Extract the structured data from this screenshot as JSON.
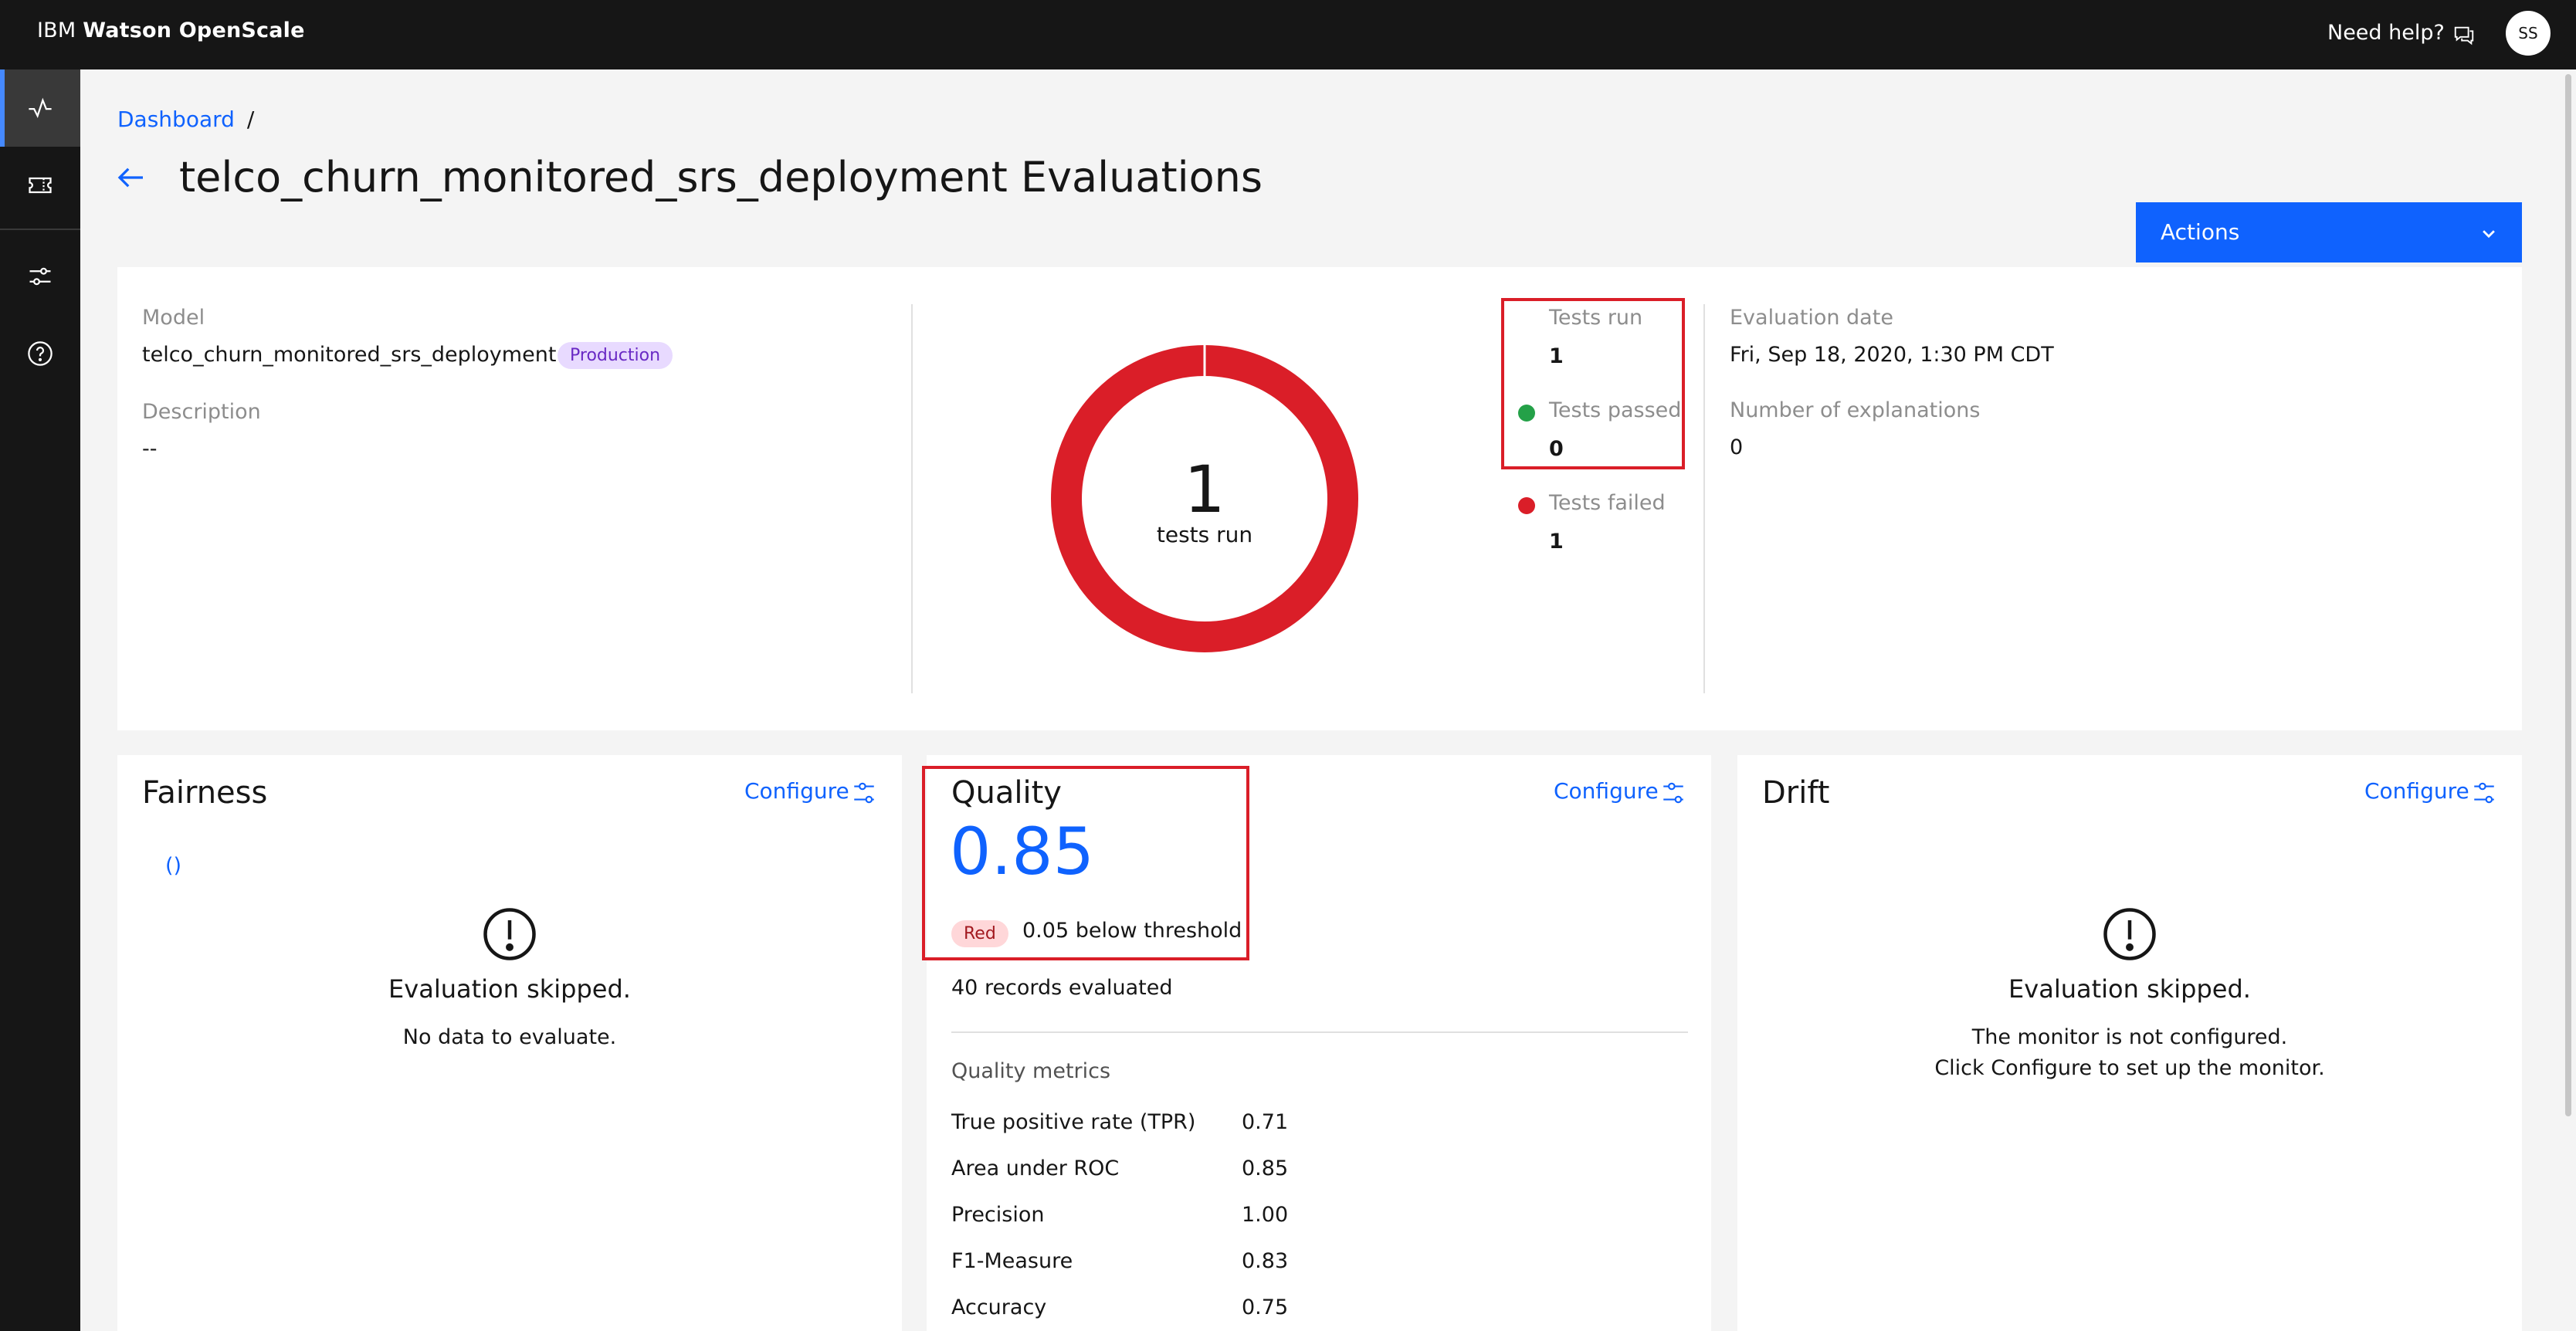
{
  "header": {
    "brand_ibm": "IBM",
    "brand_product": "Watson OpenScale",
    "help_label": "Need help?",
    "avatar_initials": "SS"
  },
  "sidenav": {
    "items": [
      {
        "icon": "activity-icon",
        "active": true
      },
      {
        "icon": "ticket-icon",
        "active": false
      },
      {
        "icon": "sliders-icon",
        "active": false
      },
      {
        "icon": "help-circle-icon",
        "active": false
      }
    ]
  },
  "breadcrumb": {
    "dashboard": "Dashboard",
    "separator": "/"
  },
  "page": {
    "title": "telco_churn_monitored_srs_deployment Evaluations"
  },
  "actions": {
    "label": "Actions"
  },
  "summary": {
    "model_label": "Model",
    "model_value": "telco_churn_monitored_srs_deployment",
    "model_tag": "Production",
    "description_label": "Description",
    "description_value": "--",
    "donut_value": "1",
    "donut_caption": "tests run",
    "tests_run_label": "Tests run",
    "tests_run_value": "1",
    "tests_passed_label": "Tests passed",
    "tests_passed_value": "0",
    "tests_failed_label": "Tests failed",
    "tests_failed_value": "1",
    "evaluation_date_label": "Evaluation date",
    "evaluation_date_value": "Fri, Sep 18, 2020, 1:30 PM CDT",
    "explanations_label": "Number of explanations",
    "explanations_value": "0"
  },
  "fairness": {
    "title": "Fairness",
    "configure": "Configure",
    "link_text": "()",
    "status": "Evaluation skipped.",
    "message": "No data to evaluate."
  },
  "quality": {
    "title": "Quality",
    "configure": "Configure",
    "score": "0.85",
    "status_tag": "Red",
    "threshold_text": "0.05 below threshold",
    "records": "40 records evaluated",
    "metrics_heading": "Quality metrics",
    "metrics": [
      {
        "name": "True positive rate (TPR)",
        "value": "0.71"
      },
      {
        "name": "Area under ROC",
        "value": "0.85"
      },
      {
        "name": "Precision",
        "value": "1.00"
      },
      {
        "name": "F1-Measure",
        "value": "0.83"
      },
      {
        "name": "Accuracy",
        "value": "0.75"
      }
    ]
  },
  "drift": {
    "title": "Drift",
    "configure": "Configure",
    "status": "Evaluation skipped.",
    "message_line1": "The monitor is not configured.",
    "message_line2": "Click Configure to set up the monitor."
  },
  "colors": {
    "accent": "#0f62fe",
    "failed": "#da1e28",
    "passed": "#24a148",
    "production_tag": "#e8daff"
  }
}
